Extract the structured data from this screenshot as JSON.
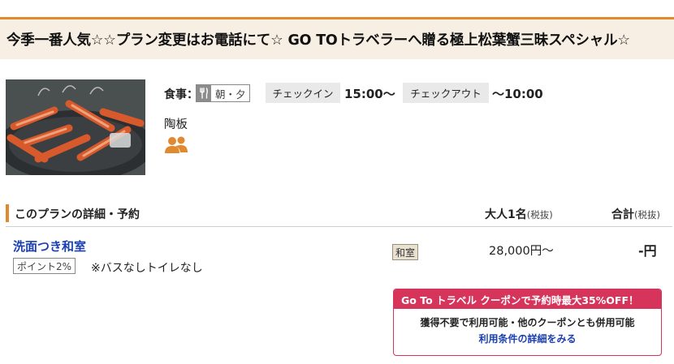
{
  "plan": {
    "title": "今季一番人気☆☆プラン変更はお電話にて☆ GO TOトラベラーへ贈る極上松葉蟹三昧スペシャル☆"
  },
  "info": {
    "meal_label": "食事：",
    "meal_value": "朝・夕",
    "meal_icon": "fork-knife-icon",
    "checkin_label": "チェックイン",
    "checkin_time": "15:00〜",
    "checkout_label": "チェックアウト",
    "checkout_time": "〜10:00",
    "feature": "陶板",
    "people_icon": "people-icon"
  },
  "section": {
    "title": "このプランの詳細・予約",
    "adult_label": "大人1名",
    "adult_note": "(税抜)",
    "total_label": "合計",
    "total_note": "(税抜)"
  },
  "room": {
    "name": "洗面つき和室",
    "point_badge": "ポイント2%",
    "notes": "※バスなしトイレなし",
    "type_badge": "和室",
    "price": "28,000円〜",
    "total": "-円"
  },
  "coupon": {
    "header": "Go To トラベル クーポンで予約時最大35%OFF！",
    "line1": "獲得不要で利用可能・他のクーポンとも併用可能",
    "link": "利用条件の詳細をみる"
  },
  "colors": {
    "accent_orange": "#e0892f",
    "coupon_red": "#d6345a",
    "link_blue": "#1a3fb0"
  }
}
